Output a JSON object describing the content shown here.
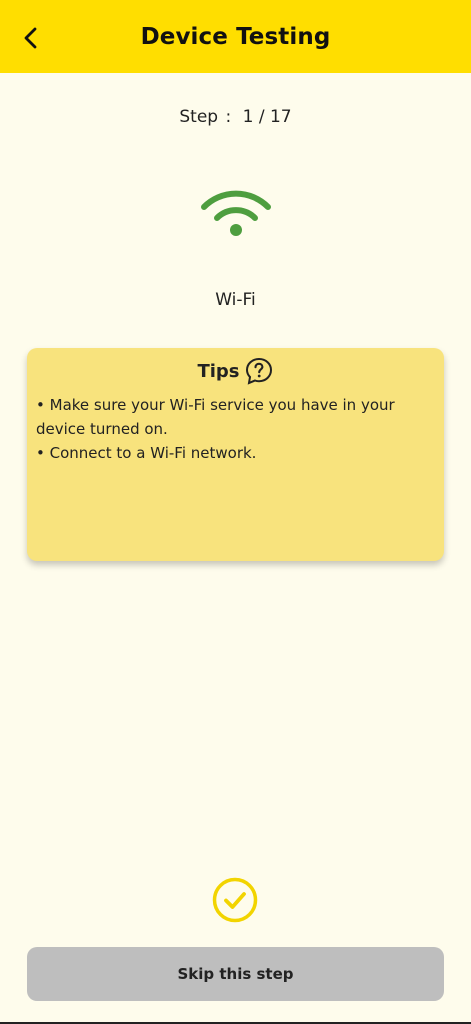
{
  "header": {
    "title": "Device Testing",
    "back_icon": "chevron-left-icon"
  },
  "step": {
    "label": "Step",
    "separator": ":",
    "current": 1,
    "total": 17,
    "value": "1 / 17"
  },
  "test": {
    "name": "Wi-Fi",
    "icon": "wifi-icon"
  },
  "tips": {
    "title": "Tips",
    "icon": "help-chat-icon",
    "items": [
      "Make sure your Wi-Fi service you have in your device turned on.",
      "Connect to a Wi-Fi network."
    ]
  },
  "status_icon": "check-circle-icon",
  "skip_button": {
    "label": "Skip this step"
  },
  "colors": {
    "header_bg": "#FFDE00",
    "page_bg": "#FEFCEC",
    "tips_bg": "#F8E37D",
    "wifi_green": "#4E9E3F",
    "check_yellow": "#F2D400",
    "button_gray": "#BEBEBE"
  }
}
